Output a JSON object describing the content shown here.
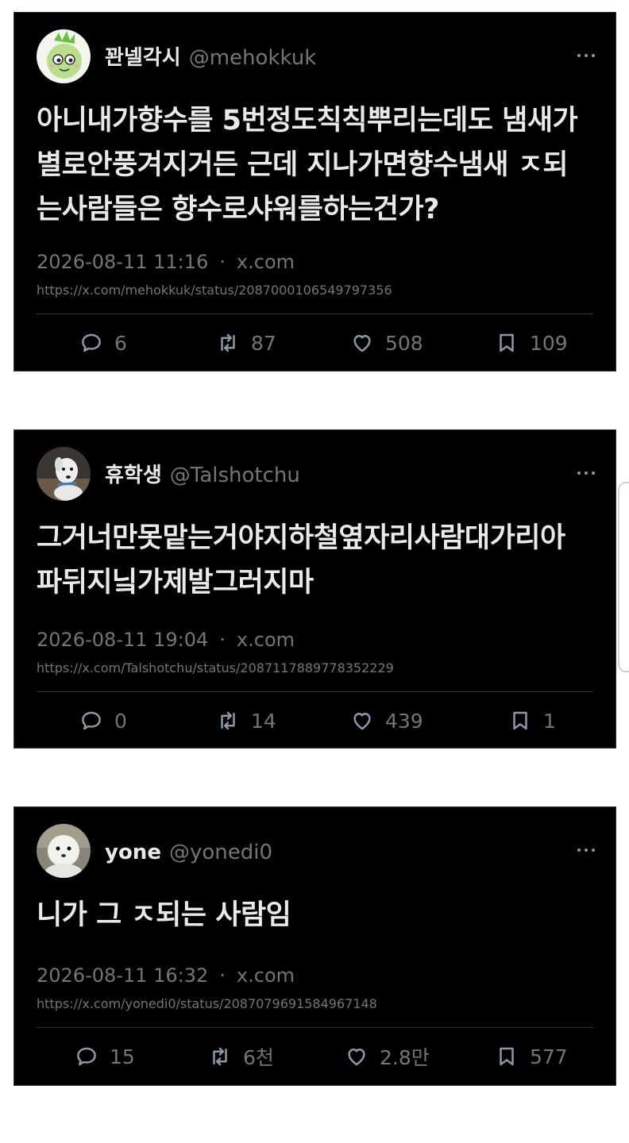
{
  "tweets": [
    {
      "display_name": "꽌넬각시",
      "handle": "@mehokkuk",
      "avatar_icon": "green-sprout-character-avatar",
      "text_lines": [
        "아니내가향수를 5번정도칙칙뿌리는데도 냄새가",
        "별로안풍겨지거든 근데 지나가면향수냄새 ㅈ되",
        "는사람들은 향수로샤워를하는건가?"
      ],
      "datetime": "2026-08-11 11:16",
      "source": "x.com",
      "separator": "·",
      "url": "https://x.com/mehokkuk/status/2087000106549797356",
      "replies": "6",
      "retweets": "87",
      "likes": "508",
      "bookmarks": "109"
    },
    {
      "display_name": "휴학생",
      "handle": "@Talshotchu",
      "avatar_icon": "white-dog-photo-avatar",
      "text_lines": [
        "그거너만못맡는거야지하철옆자리사람대가리아",
        "파뒤지닠가제발그러지마"
      ],
      "datetime": "2026-08-11 19:04",
      "source": "x.com",
      "separator": "·",
      "url": "https://x.com/Talshotchu/status/2087117889778352229",
      "replies": "0",
      "retweets": "14",
      "likes": "439",
      "bookmarks": "1"
    },
    {
      "display_name": "yone",
      "handle": "@yonedi0",
      "avatar_icon": "white-plush-character-avatar",
      "text_lines": [
        "니가 그 ㅈ되는 사람임"
      ],
      "datetime": "2026-08-11 16:32",
      "source": "x.com",
      "separator": "·",
      "url": "https://x.com/yonedi0/status/2087079691584967148",
      "replies": "15",
      "retweets": "6천",
      "likes": "2.8만",
      "bookmarks": "577"
    }
  ],
  "colors": {
    "card_background": "#000000",
    "text_primary": "#e7e9ea",
    "text_secondary": "#71767b",
    "page_background": "#ffffff"
  }
}
